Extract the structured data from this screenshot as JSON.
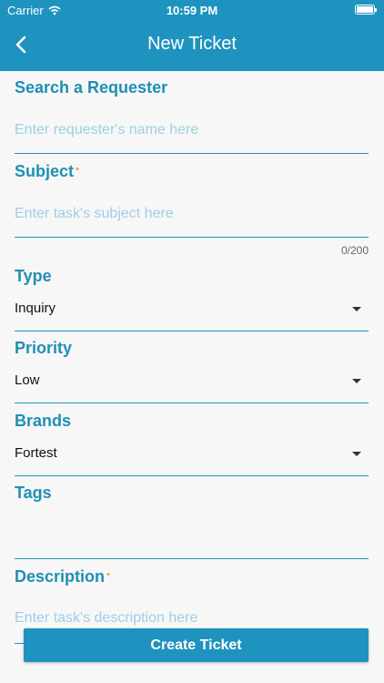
{
  "status_bar": {
    "carrier": "Carrier",
    "time": "10:59 PM"
  },
  "header": {
    "title": "New Ticket",
    "back_icon": "chevron-left-icon"
  },
  "fields": {
    "requester": {
      "label": "Search a Requester",
      "placeholder": "Enter requester's name here"
    },
    "subject": {
      "label": "Subject",
      "required_mark": "•",
      "placeholder": "Enter task's subject here",
      "counter": "0/200"
    },
    "type": {
      "label": "Type",
      "value": "Inquiry"
    },
    "priority": {
      "label": "Priority",
      "value": "Low"
    },
    "brands": {
      "label": "Brands",
      "value": "Fortest"
    },
    "tags": {
      "label": "Tags"
    },
    "description": {
      "label": "Description",
      "required_mark": "•",
      "placeholder": "Enter task's description here"
    }
  },
  "actions": {
    "create": "Create Ticket"
  },
  "colors": {
    "accent": "#1f93bf",
    "label": "#1f8fb6",
    "placeholder": "#9fcfe3",
    "required": "#f2a23c"
  }
}
